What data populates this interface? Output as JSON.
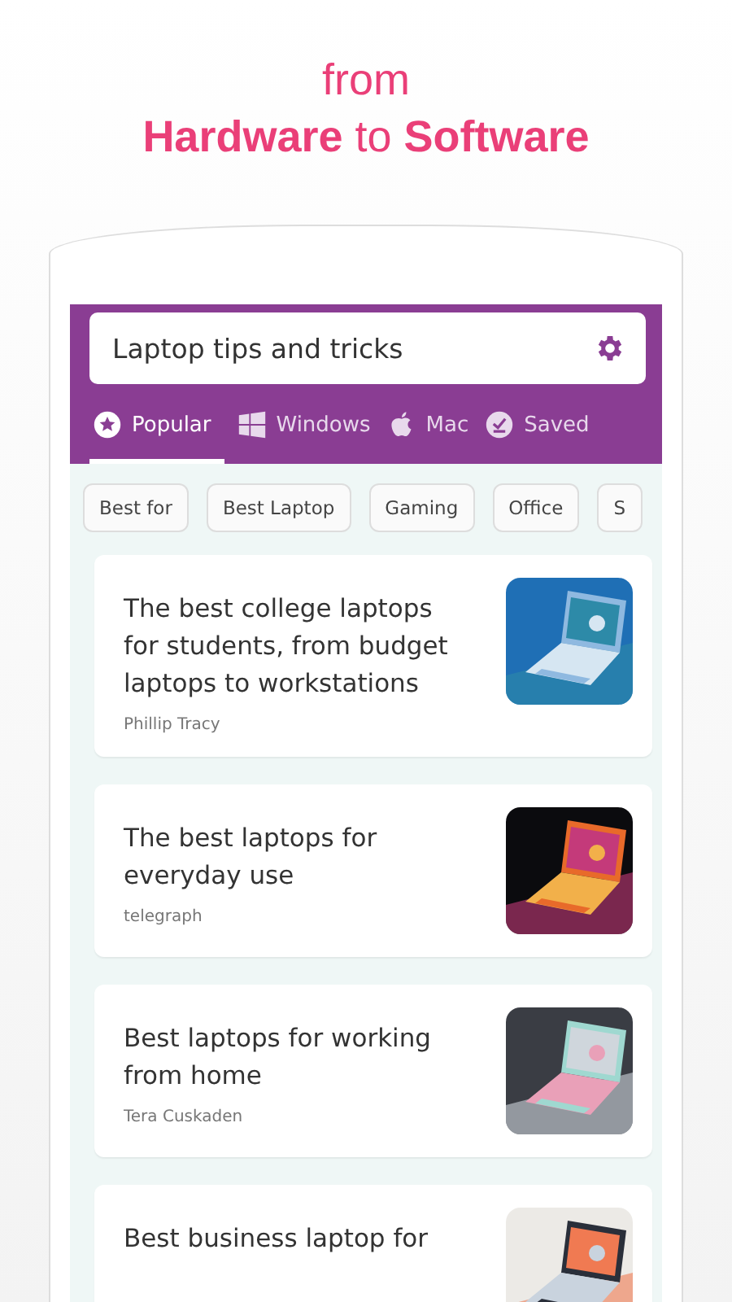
{
  "headline": {
    "intro": "from",
    "title": "**Hardware** to **Software**"
  },
  "search": {
    "value": "Laptop tips and tricks"
  },
  "tabs": [
    {
      "label": "Popular",
      "kind": "star",
      "selected": true
    },
    {
      "label": "Windows",
      "kind": "windows",
      "selected": false
    },
    {
      "label": "Mac",
      "kind": "apple",
      "selected": false
    },
    {
      "label": "Saved",
      "kind": "saved",
      "selected": false
    }
  ],
  "chips": [
    "Best for",
    "Best Laptop",
    "Gaming",
    "Office",
    "S"
  ],
  "articles": [
    {
      "title": "The best college laptops for students, from budget laptops to workstations",
      "source": "Phillip Tracy",
      "kind": "picture"
    },
    {
      "title": "The best laptops for everyday use",
      "source": "telegraph",
      "kind": "picture"
    },
    {
      "title": "Best laptops for working from home",
      "source": "Tera Cuskaden",
      "kind": "picture"
    },
    {
      "title": "Best business laptop for",
      "kind": "picture"
    }
  ]
}
